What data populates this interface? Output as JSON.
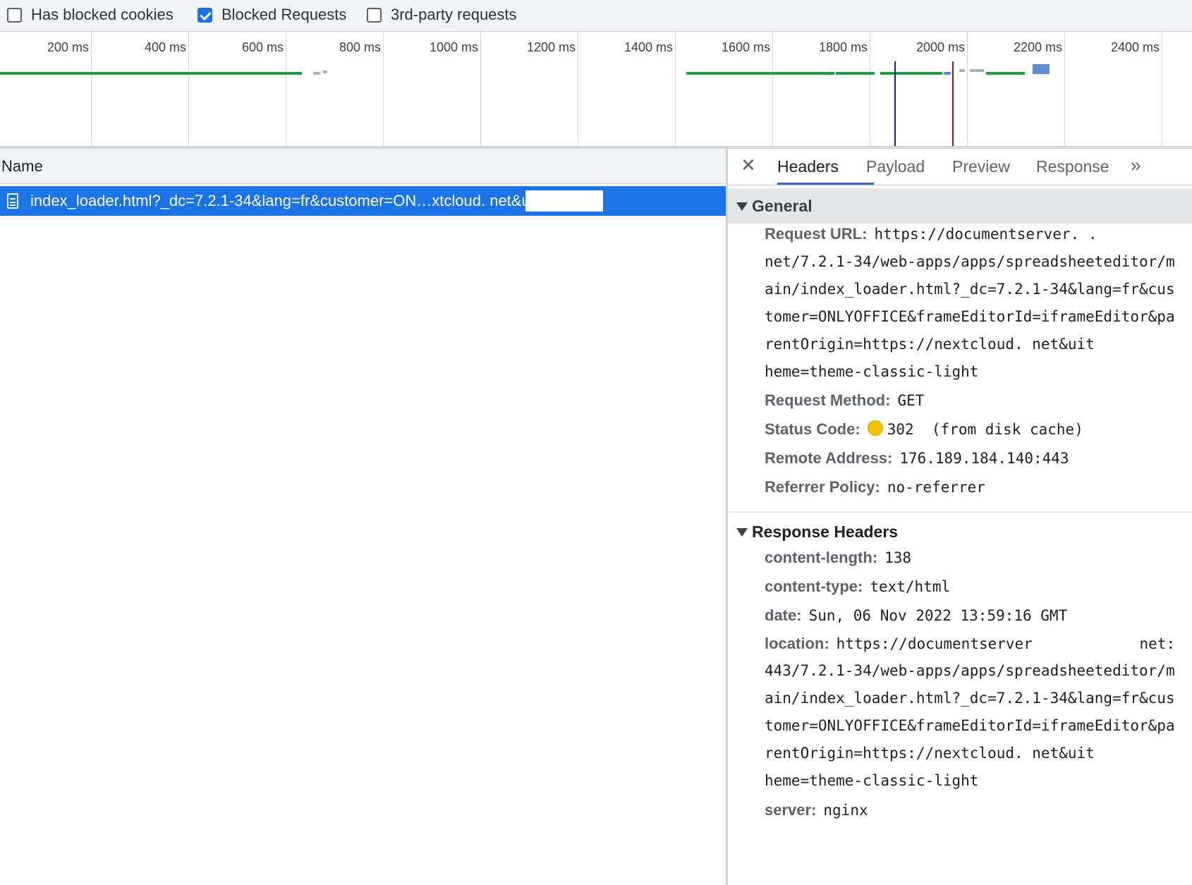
{
  "filters": {
    "has_blocked_cookies": {
      "label": "Has blocked cookies",
      "checked": false
    },
    "blocked_requests": {
      "label": "Blocked Requests",
      "checked": true
    },
    "third_party_requests": {
      "label": "3rd-party requests",
      "checked": false
    }
  },
  "overview": {
    "ticks": [
      "200 ms",
      "400 ms",
      "600 ms",
      "800 ms",
      "1000 ms",
      "1200 ms",
      "1400 ms",
      "1600 ms",
      "1800 ms",
      "2000 ms",
      "2200 ms",
      "2400 ms"
    ],
    "dom_content_loaded_color": "#1a237e",
    "load_color": "#8b1a1a",
    "bar_color": "#1e9e3e"
  },
  "list": {
    "column_name": "Name",
    "selected_row": {
      "icon": "document-icon",
      "name": "index_loader.html?_dc=7.2.1-34&lang=fr&customer=ON…xtcloud.                          net&uitheme…"
    }
  },
  "details": {
    "tabs": [
      "Headers",
      "Payload",
      "Preview",
      "Response"
    ],
    "active_tab": "Headers",
    "general": {
      "title": "General",
      "request_url_key": "Request URL:",
      "request_url_lines": [
        "https://documentserver.        .",
        "net/7.2.1-34/web-apps/apps/spreadsheeteditor/m",
        "ain/index_loader.html?_dc=7.2.1-34&lang=fr&cus",
        "tomer=ONLYOFFICE&frameEditorId=iframeEditor&pa",
        "rentOrigin=https://nextcloud.           net&uit",
        "heme=theme-classic-light"
      ],
      "request_method_key": "Request Method:",
      "request_method": "GET",
      "status_code_key": "Status Code:",
      "status_code": "302  (from disk cache)",
      "remote_address_key": "Remote Address:",
      "remote_address": "176.189.184.140:443",
      "referrer_policy_key": "Referrer Policy:",
      "referrer_policy": "no-referrer"
    },
    "response_headers": {
      "title": "Response Headers",
      "content_length_key": "content-length:",
      "content_length": "138",
      "content_type_key": "content-type:",
      "content_type": "text/html",
      "date_key": "date:",
      "date": "Sun, 06 Nov 2022 13:59:16 GMT",
      "location_key": "location:",
      "location_lines": [
        "https://documentserver            net:",
        "443/7.2.1-34/web-apps/apps/spreadsheeteditor/m",
        "ain/index_loader.html?_dc=7.2.1-34&lang=fr&cus",
        "tomer=ONLYOFFICE&frameEditorId=iframeEditor&pa",
        "rentOrigin=https://nextcloud.           net&uit",
        "heme=theme-classic-light"
      ],
      "server_key": "server:",
      "server": "nginx"
    }
  }
}
